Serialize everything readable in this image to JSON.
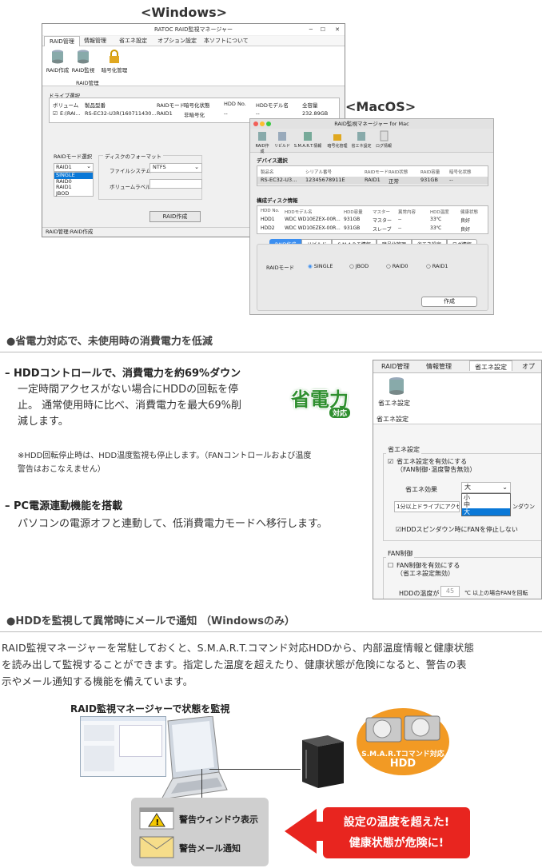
{
  "labels": {
    "windows": "<Windows>",
    "macos": "<MacOS>"
  },
  "win": {
    "title": "RATOC RAID監視マネージャー",
    "tabs": [
      "RAID管理",
      "情報管理",
      "省エネ設定",
      "オプション設定",
      "本ソフトについて"
    ],
    "tools": [
      "RAID作成",
      "RAID監視",
      "暗号化管理"
    ],
    "group": "RAID管理",
    "drive_label": "ドライブ選択",
    "cols": [
      "ボリューム",
      "製品型番",
      "RAIDモード",
      "暗号化状態",
      "HDD No.",
      "HDDモデル名",
      "全容量"
    ],
    "row": [
      "E:(RAI...",
      "RS-EC32-U3R(160711430...",
      "RAID1",
      "非暗号化",
      "--",
      "--",
      "232.89GB"
    ],
    "mode_label": "RAIDモード選択",
    "mode_value": "RAID1",
    "mode_opts": [
      "SINGLE",
      "RAID0",
      "RAID1",
      "JBOD"
    ],
    "format_label": "ディスクのフォーマット",
    "fs_label": "ファイルシステム",
    "fs_value": "NTFS",
    "vol_label": "ボリュームラベル",
    "create_btn": "RAID作成",
    "status": "RAID管理:RAID作成"
  },
  "mac": {
    "title": "RAID監視マネージャー for Mac",
    "tools": [
      "RAID作成",
      "リビルド",
      "S.M.A.R.T.情報",
      "暗号化管理",
      "省エネ設定",
      "ログ情報"
    ],
    "dev_label": "デバイス選択",
    "dev_cols": [
      "製品名",
      "シリアル番号",
      "RAIDモード",
      "RAID状態",
      "RAID容量",
      "暗号化状態"
    ],
    "dev_row": [
      "RS-EC32-U3...",
      "12345678911E",
      "RAID1",
      "正常",
      "931GB",
      "--"
    ],
    "disk_label": "構成ディスク情報",
    "disk_cols": [
      "HDD No.",
      "HDDモデル名",
      "HDD容量",
      "マスター",
      "異常内容",
      "HDD温度",
      "健康状態"
    ],
    "disks": [
      [
        "HDD1",
        "WDC WD10EZEX-00R...",
        "931GB",
        "マスター",
        "--",
        "33℃",
        "良好"
      ],
      [
        "HDD2",
        "WDC WD10EZEX-00R...",
        "931GB",
        "スレーブ",
        "--",
        "33℃",
        "良好"
      ]
    ],
    "tabs": [
      "RAID作成",
      "リビルド",
      "S.M.A.R.T.情報",
      "暗号化管理",
      "省エネ設定",
      "ログ情報"
    ],
    "mode_label": "RAIDモード",
    "radios": [
      "SINGLE",
      "JBOD",
      "RAID0",
      "RAID1"
    ],
    "create_btn": "作成"
  },
  "sec1": {
    "heading": "●省電力対応で、未使用時の消費電力を低減",
    "h1": "– HDDコントロールで、消費電力を約69%ダウン",
    "p1": [
      "一定時間アクセスがない場合にHDDの回転を停",
      "止。 通常使用時に比べ、消費電力を最大69%削",
      "減します。"
    ],
    "note": [
      "※HDD回転停止時は、HDD温度監視も停止します。（FANコントロールおよび温度",
      "警告はおこなえません）"
    ],
    "h2": "– PC電源連動機能を搭載",
    "p2": "パソコンの電源オフと連動して、低消費電力モードへ移行します。",
    "badge_main": "省電力",
    "badge_sub": "対応"
  },
  "eco": {
    "tabs": [
      "RAID管理",
      "情報管理",
      "省エネ設定",
      "オプ"
    ],
    "tool": "省エネ設定",
    "group": "省エネ設定",
    "box_label": "省エネ設定",
    "check1": [
      "省エネ設定を有効にする",
      "（FAN制御･温度警告無効）"
    ],
    "effect_label": "省エネ効果",
    "effect_value": "大",
    "effect_opts": [
      "小",
      "中",
      "大"
    ],
    "desc": "1分以上ドライブにアクセ",
    "desc_tail": "ンダウン",
    "check2": "HDDスピンダウン時にFANを停止しない",
    "fan_label": "FAN制御",
    "check3": [
      "FAN制御を有効にする",
      "（省エネ設定無効）"
    ],
    "temp_label": "HDDの温度が",
    "temp_value": "45",
    "temp_tail": "℃ 以上の場合FANを回転"
  },
  "sec2": {
    "heading": "●HDDを監視して異常時にメールで通知 （Windowsのみ）",
    "para": [
      "RAID監視マネージャーを常駐しておくと、S.M.A.R.T.コマンド対応HDDから、内部温度情報と健康状態",
      "を読み出して監視することができます。指定した温度を超えたり、健康状態が危険になると、警告の表",
      "示やメール通知する機能を備えています。"
    ]
  },
  "diagram": {
    "title": "RAID監視マネージャーで状態を監視",
    "hdd_label1": "S.M.A.R.Tコマンド対応",
    "hdd_label2": "HDD",
    "warn_window": "警告ウィンドウ表示",
    "warn_mail": "警告メール通知",
    "alert1": "設定の温度を超えた!",
    "alert2": "健康状態が危険に!"
  },
  "colors": {
    "accent": "#0a7fd8",
    "alert": "#e8251f",
    "badge": "#2f8f2f"
  }
}
